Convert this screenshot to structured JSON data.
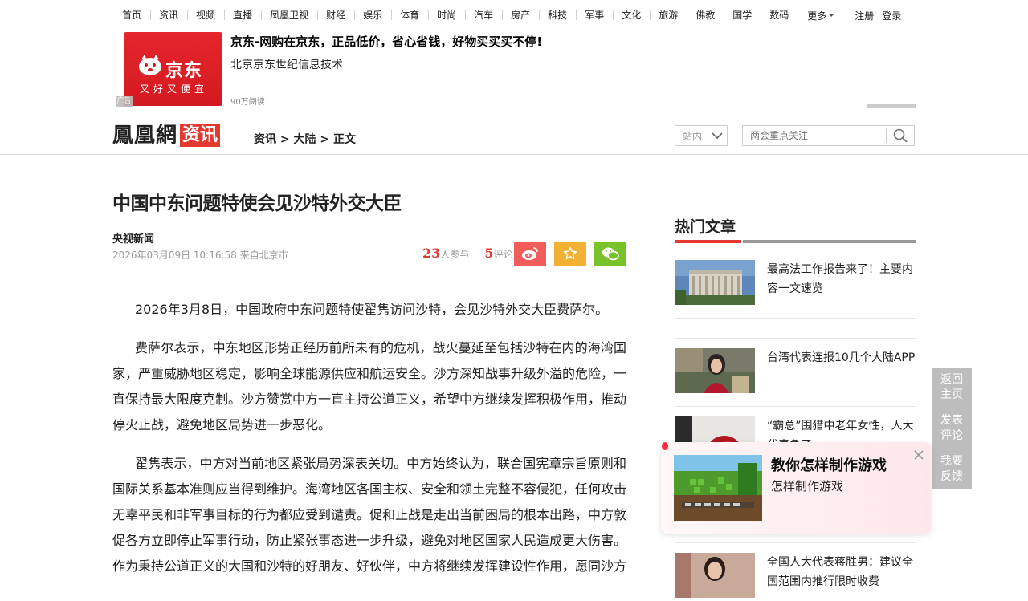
{
  "top_nav": {
    "items": [
      "首页",
      "资讯",
      "视频",
      "直播",
      "凤凰卫视",
      "财经",
      "娱乐",
      "体育",
      "时尚",
      "汽车",
      "房产",
      "科技",
      "军事",
      "文化",
      "旅游",
      "佛教",
      "国学",
      "数码"
    ],
    "more_label": "更多",
    "register_label": "注册",
    "login_label": "登录"
  },
  "ad": {
    "brand_name": "京东",
    "brand_slogan": "又好又便宜",
    "badge": "广告",
    "title": "京东-网购在京东，正品低价，省心省钱，好物买买买不停!",
    "company": "北京京东世纪信息技术",
    "reads": "90万阅读",
    "brand_color": "#e4262d"
  },
  "header": {
    "logo_text": "鳳凰網",
    "logo_badge": "资讯",
    "breadcrumb": "资讯 > 大陆 > 正文",
    "site_select": "站内",
    "search_placeholder": "两会重点关注"
  },
  "article": {
    "title": "中国中东问题特使会见沙特外交大臣",
    "source": "央视新闻",
    "meta": "2026年03月09日 10:16:58 来自北京市",
    "participants_count": "23",
    "participants_label": "人参与",
    "comments_count": "5",
    "comments_label": "评论",
    "paragraphs": [
      "2026年3月8日，中国政府中东问题特使翟隽访问沙特，会见沙特外交大臣费萨尔。",
      "费萨尔表示，中东地区形势正经历前所未有的危机，战火蔓延至包括沙特在内的海湾国家，严重威胁地区稳定，影响全球能源供应和航运安全。沙方深知战事升级外溢的危险，一直保持最大限度克制。沙方赞赏中方一直主持公道正义，希望中方继续发挥积极作用，推动停火止战，避免地区局势进一步恶化。",
      "翟隽表示，中方对当前地区紧张局势深表关切。中方始终认为，联合国宪章宗旨原则和国际关系基本准则应当得到维护。海湾地区各国主权、安全和领土完整不容侵犯，任何攻击无辜平民和非军事目标的行为都应受到谴责。促和止战是走出当前困局的根本出路，中方敦促各方立即停止军事行动，防止紧张事态进一步升级，避免对地区国家人民造成更大伤害。作为秉持公道正义的大国和沙特的好朋友、好伙伴，中方将继续发挥建设性作用，愿同沙方"
    ]
  },
  "sidebar": {
    "hot_title": "热门文章",
    "items": [
      "最高法工作报告来了！主要内容一文速览",
      "台湾代表连报10几个大陆APP",
      "“霸总”围猎中老年女性，人大代表急了",
      "全国人大代表蒋胜男：建议全国范围内推行限时收费"
    ]
  },
  "float_buttons": {
    "home": "返回主页",
    "comment": "发表评论",
    "feedback": "我要反馈"
  },
  "popup": {
    "title": "教你怎样制作游戏",
    "subtitle": "怎样制作游戏"
  }
}
